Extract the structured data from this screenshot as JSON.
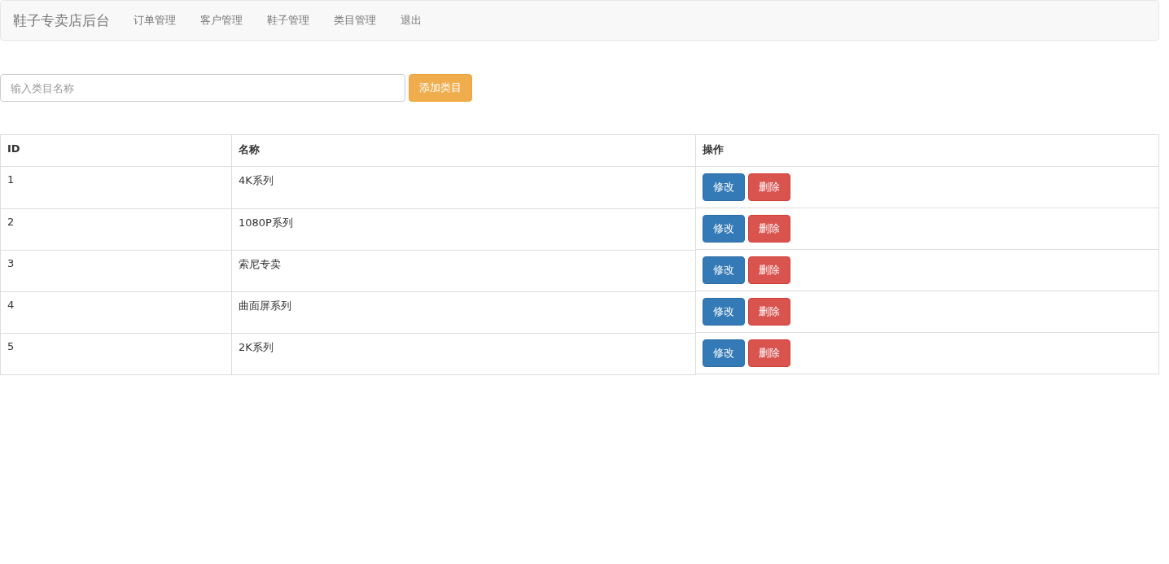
{
  "navbar": {
    "brand": "鞋子专卖店后台",
    "items": [
      "订单管理",
      "客户管理",
      "鞋子管理",
      "类目管理",
      "退出"
    ]
  },
  "add_form": {
    "placeholder": "输入类目名称",
    "button": "添加类目"
  },
  "table": {
    "columns": [
      "ID",
      "名称",
      "操作"
    ],
    "rows": [
      {
        "id": "1",
        "name": "4K系列",
        "actions": [
          "修改",
          "删除"
        ]
      },
      {
        "id": "2",
        "name": "1080P系列",
        "actions": [
          "修改",
          "删除"
        ]
      },
      {
        "id": "3",
        "name": "索尼专卖",
        "actions": [
          "修改",
          "删除"
        ]
      },
      {
        "id": "4",
        "name": "曲面屏系列",
        "actions": [
          "修改",
          "删除"
        ]
      },
      {
        "id": "5",
        "name": "2K系列",
        "actions": [
          "修改",
          "删除"
        ]
      }
    ]
  }
}
